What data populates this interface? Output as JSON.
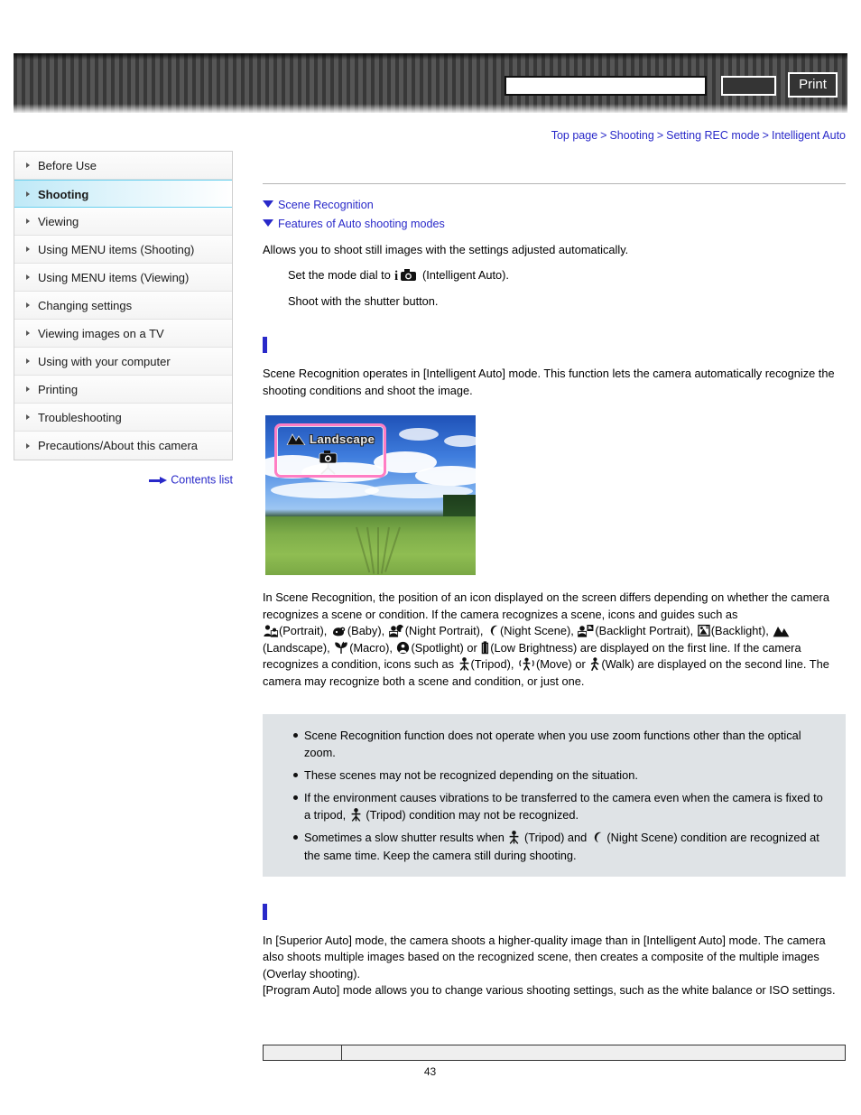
{
  "header": {
    "search_value": "",
    "search_placeholder": "",
    "search_button_label": "",
    "print_button_label": "Print"
  },
  "breadcrumb": {
    "separator": ">",
    "items": [
      {
        "label": "Top page"
      },
      {
        "label": "Shooting"
      },
      {
        "label": "Setting REC mode"
      },
      {
        "label": "Intelligent Auto"
      }
    ]
  },
  "sidebar": {
    "items": [
      {
        "label": "Before Use",
        "active": false
      },
      {
        "label": "Shooting",
        "active": true
      },
      {
        "label": "Viewing",
        "active": false
      },
      {
        "label": "Using MENU items (Shooting)",
        "active": false
      },
      {
        "label": "Using MENU items (Viewing)",
        "active": false
      },
      {
        "label": "Changing settings",
        "active": false
      },
      {
        "label": "Viewing images on a TV",
        "active": false
      },
      {
        "label": "Using with your computer",
        "active": false
      },
      {
        "label": "Printing",
        "active": false
      },
      {
        "label": "Troubleshooting",
        "active": false
      },
      {
        "label": "Precautions/About this camera",
        "active": false
      }
    ],
    "contents_link_label": "Contents list"
  },
  "main": {
    "page_title": "",
    "jump_links": [
      {
        "label": "Scene Recognition"
      },
      {
        "label": "Features of Auto shooting modes"
      }
    ],
    "lead": "Allows you to shoot still images with the settings adjusted automatically.",
    "steps": [
      {
        "before": "Set the mode dial to ",
        "icon": "intelligent-auto-mode-icon",
        "after": " (Intelligent Auto)."
      },
      {
        "before": "Shoot with the shutter button.",
        "icon": "",
        "after": ""
      }
    ],
    "section1": {
      "heading": "",
      "paragraph": "Scene Recognition operates in [Intelligent Auto] mode. This function lets the camera automatically recognize the shooting conditions and shoot the image.",
      "figure": {
        "osd_label": "Landscape",
        "osd_scene_icon": "mountain-icon",
        "osd_condition_icon": "camera-tripod-icon"
      },
      "body_p1": "In Scene Recognition, the position of an icon displayed on the screen differs depending on whether the camera recognizes a scene or condition. If the camera recognizes a scene, icons and guides such as",
      "scene_icons": [
        {
          "icon": "portrait-icon",
          "label": "(Portrait),"
        },
        {
          "icon": "baby-icon",
          "label": "(Baby),"
        },
        {
          "icon": "night-portrait-icon",
          "label": "(Night Portrait),"
        },
        {
          "icon": "night-scene-icon",
          "label": "(Night Scene),"
        },
        {
          "icon": "backlight-portrait-icon",
          "label": "(Backlight Portrait),"
        },
        {
          "icon": "backlight-icon",
          "label": "(Backlight),"
        },
        {
          "icon": "landscape-icon",
          "label": "(Landscape),"
        },
        {
          "icon": "macro-icon",
          "label": "(Macro),"
        },
        {
          "icon": "spotlight-icon",
          "label": "(Spotlight) or"
        },
        {
          "icon": "low-brightness-icon",
          "label": "(Low Brightness)"
        }
      ],
      "body_p2": "are displayed on the first line. If the camera recognizes a condition, icons such as",
      "condition_icons": [
        {
          "icon": "tripod-icon",
          "label": "(Tripod),"
        },
        {
          "icon": "move-icon",
          "label": "(Move) or"
        },
        {
          "icon": "walk-icon",
          "label": "(Walk)"
        }
      ],
      "body_p3": "are displayed on the second line. The camera may recognize both a scene and condition, or just one."
    },
    "notes": [
      {
        "text": "Scene Recognition function does not operate when you use zoom functions other than the optical zoom."
      },
      {
        "text": "These scenes may not be recognized depending on the situation."
      },
      {
        "text_before": "If the environment causes vibrations to be transferred to the camera even when the camera is fixed to a tripod, ",
        "icon1": "tripod-icon",
        "text_after": " (Tripod) condition may not be recognized."
      },
      {
        "text_before": "Sometimes a slow shutter results when ",
        "icon1": "tripod-icon",
        "text_mid": " (Tripod) and ",
        "icon2": "night-scene-icon",
        "text_after": " (Night Scene) condition are recognized at the same time. Keep the camera still during shooting."
      }
    ],
    "section2": {
      "heading": "",
      "paragraph1": "In [Superior Auto] mode, the camera shoots a higher-quality image than in [Intelligent Auto] mode. The camera also shoots multiple images based on the recognized scene, then creates a composite of the multiple images (Overlay shooting).",
      "paragraph2": "[Program Auto] mode allows you to change various shooting settings, such as the white balance or ISO settings."
    },
    "bottom_table": {
      "cell1": "",
      "cell2": ""
    }
  },
  "footer": {
    "page_number": "43"
  },
  "colors": {
    "link_blue": "#2929c9",
    "accent_bar": "#2929c9",
    "sidebar_active": "#bfe9f7",
    "notes_bg": "#dfe3e6",
    "osd_border_pink": "#ff7ec4"
  }
}
